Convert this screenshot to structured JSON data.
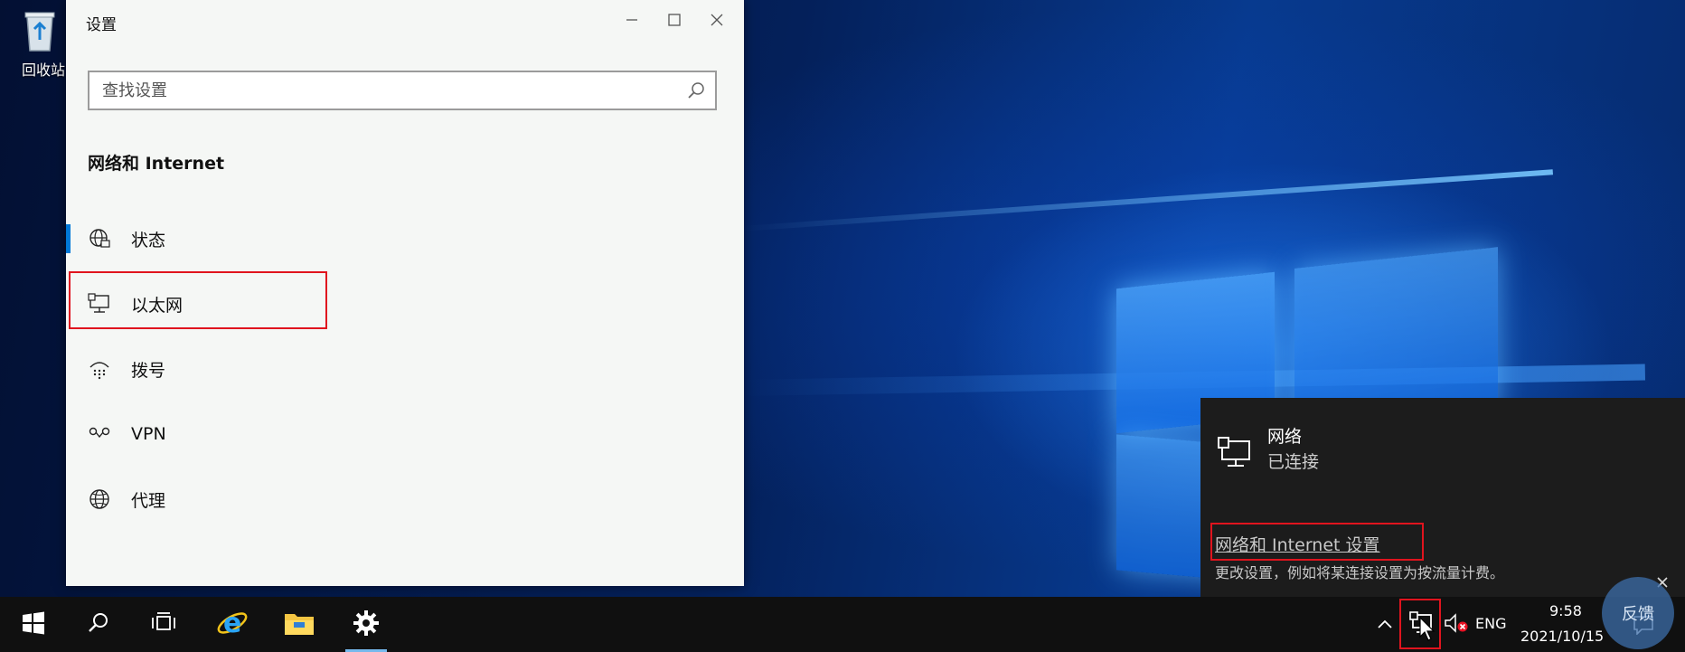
{
  "desktop": {
    "recycle_bin_label": "回收站"
  },
  "settings_window": {
    "title": "设置",
    "search": {
      "placeholder": "查找设置",
      "value": ""
    },
    "section_title": "网络和 Internet",
    "nav_items": [
      {
        "label": "状态",
        "icon": "globe-status-icon",
        "active": true
      },
      {
        "label": "以太网",
        "icon": "ethernet-icon",
        "active": false
      },
      {
        "label": "拨号",
        "icon": "dialup-icon",
        "active": false
      },
      {
        "label": "VPN",
        "icon": "vpn-icon",
        "active": false
      },
      {
        "label": "代理",
        "icon": "globe-icon",
        "active": false
      }
    ]
  },
  "network_flyout": {
    "network_name": "网络",
    "network_status": "已连接",
    "settings_link": "网络和 Internet 设置",
    "description": "更改设置，例如将某连接设置为按流量计费。"
  },
  "taskbar": {
    "tray": {
      "language": "ENG",
      "time": "9:58",
      "date": "2021/10/15"
    },
    "feedback_label": "反馈"
  },
  "colors": {
    "accent": "#0078d7",
    "highlight_box": "#e0141e",
    "taskbar_bg": "#101010",
    "flyout_bg": "#1c1c1c"
  }
}
